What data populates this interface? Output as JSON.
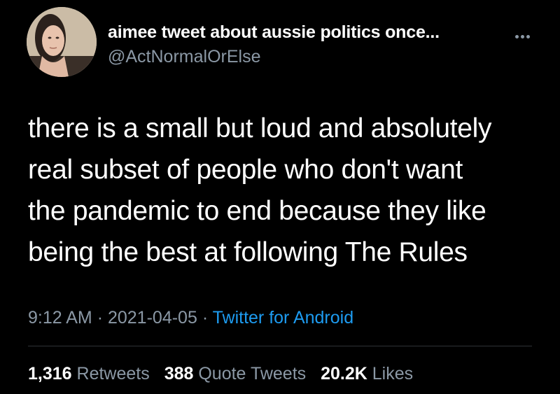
{
  "author": {
    "display_name": "aimee tweet about aussie politics once...",
    "handle": "@ActNormalOrElse"
  },
  "tweet": {
    "text_lines": [
      "there is a small but loud and absolutely",
      "real subset of people who don't want",
      "the pandemic to end because they like",
      "being the best at following The Rules"
    ],
    "time": "9:12 AM",
    "date": "2021-04-05",
    "source": "Twitter for Android"
  },
  "stats": {
    "retweets_count": "1,316",
    "retweets_label": "Retweets",
    "quotes_count": "388",
    "quotes_label": "Quote Tweets",
    "likes_count": "20.2K",
    "likes_label": "Likes"
  },
  "icons": {
    "more": "more-options-icon",
    "avatar": "profile-photo"
  },
  "colors": {
    "background": "#000000",
    "text": "#ffffff",
    "secondary": "#8b98a5",
    "link": "#1d9bf0"
  }
}
